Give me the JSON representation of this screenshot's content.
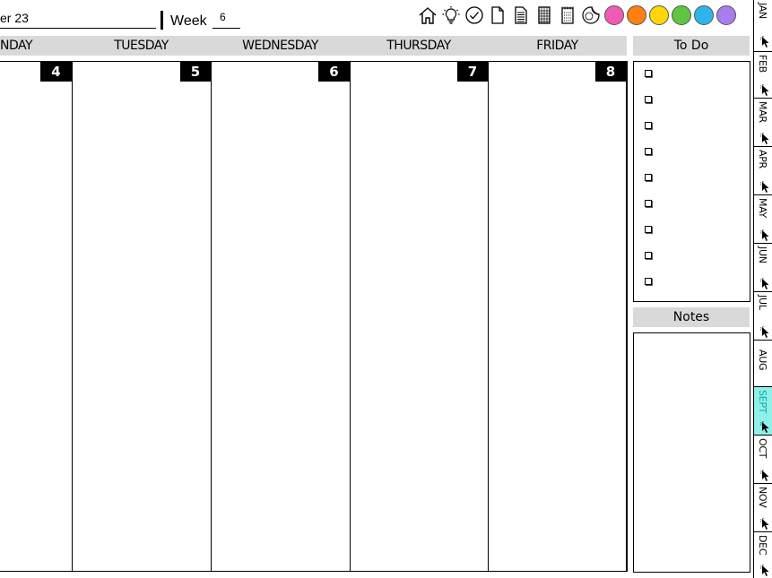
{
  "header": {
    "date_text": "er 23",
    "week_label": "Week",
    "week_value": "6"
  },
  "toolbar": {
    "icons": [
      "home-icon",
      "lightbulb-icon",
      "check-circle-icon",
      "page-icon",
      "lined-page-icon",
      "grid-page-icon",
      "dotted-page-icon",
      "sticker-icon"
    ],
    "swatches": [
      "#f15bb5",
      "#ff7f11",
      "#ffd60a",
      "#5ec641",
      "#2fb4e9",
      "#a97cf0"
    ]
  },
  "days": [
    {
      "name": "NDAY",
      "number": "4"
    },
    {
      "name": "TUESDAY",
      "number": "5"
    },
    {
      "name": "WEDNESDAY",
      "number": "6"
    },
    {
      "name": "THURSDAY",
      "number": "7"
    },
    {
      "name": "FRIDAY",
      "number": "8"
    }
  ],
  "todo": {
    "title": "To Do",
    "items": [
      "",
      "",
      "",
      "",
      "",
      "",
      "",
      "",
      ""
    ]
  },
  "notes": {
    "title": "Notes"
  },
  "months": [
    "JAN",
    "FEB",
    "MAR",
    "APR",
    "MAY",
    "JUN",
    "JUL",
    "AUG",
    "SEPT",
    "OCT",
    "NOV",
    "DEC"
  ],
  "active_month": "SEPT",
  "active_color": "#8ff0ea"
}
